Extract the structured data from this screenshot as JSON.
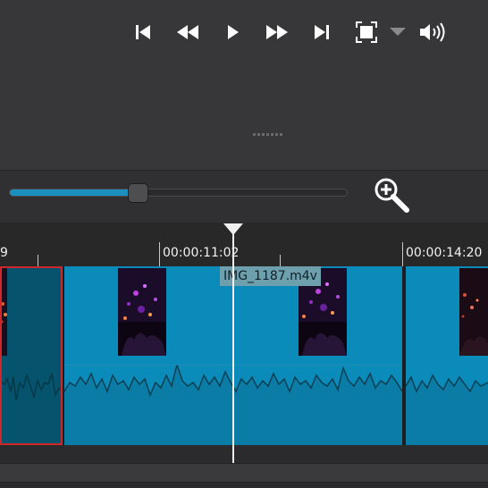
{
  "player": {
    "buttons": [
      {
        "name": "skip-to-start-icon"
      },
      {
        "name": "rewind-icon"
      },
      {
        "name": "play-icon"
      },
      {
        "name": "fast-forward-icon"
      },
      {
        "name": "skip-to-end-icon"
      },
      {
        "name": "fullscreen-icon"
      },
      {
        "name": "dropdown-arrow-icon"
      },
      {
        "name": "volume-icon"
      }
    ]
  },
  "zoom": {
    "level": 0.38,
    "icon": "zoom-in-icon"
  },
  "ruler": {
    "labels": [
      "9",
      "00:00:11:02",
      "00:00:14:20"
    ]
  },
  "track": {
    "clip_name": "IMG_1187.m4v"
  },
  "colors": {
    "clip": "#0a8bb9",
    "selected_clip": "#05536d",
    "selection_border": "#d1262b",
    "zoom_fill": "#1b90c0"
  }
}
